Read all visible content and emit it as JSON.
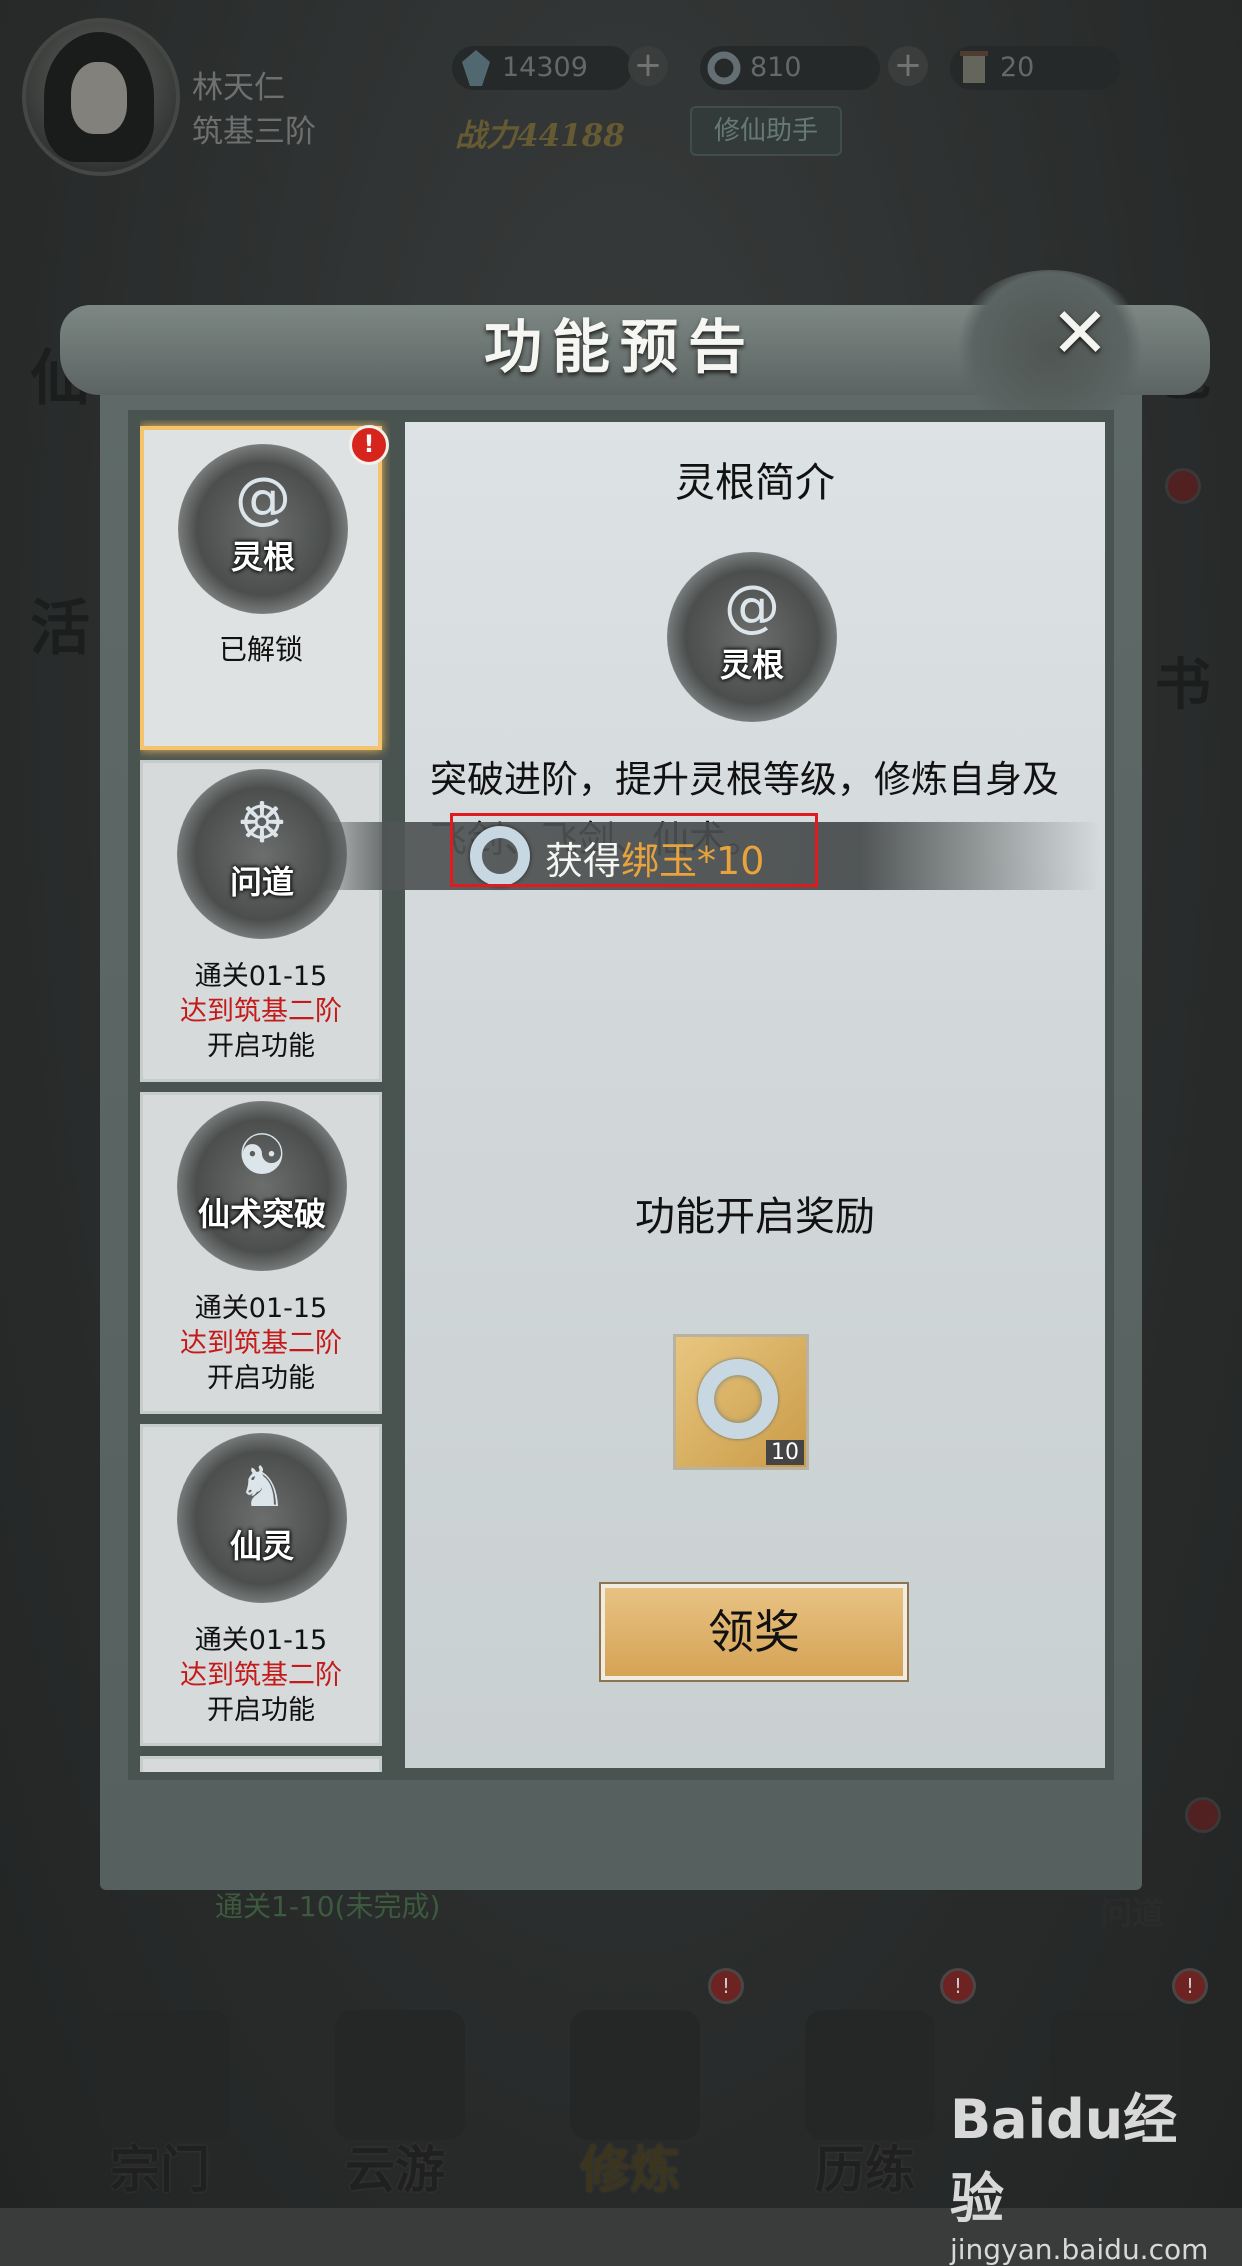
{
  "player": {
    "name": "林天仁",
    "rank": "筑基三阶"
  },
  "resources": [
    {
      "icon": "spirit-stone-icon",
      "value": "14309"
    },
    {
      "icon": "jade-ring-icon",
      "value": "810"
    },
    {
      "icon": "scroll-icon",
      "value": "20"
    }
  ],
  "power": "战力44188",
  "helper_button": "修仙助手",
  "modal": {
    "title": "功能预告",
    "close_icon": "close-icon"
  },
  "features": [
    {
      "emblem": "灵根",
      "icon": "spirit-root-icon",
      "status": "已解锁",
      "active": true,
      "badge": "!"
    },
    {
      "emblem": "问道",
      "icon": "meditation-icon",
      "cond1": "通关01-15",
      "cond2": "达到筑基二阶",
      "cond3": "开启功能"
    },
    {
      "emblem": "仙术突破",
      "icon": "yin-yang-icon",
      "cond1": "通关01-15",
      "cond2": "达到筑基二阶",
      "cond3": "开启功能"
    },
    {
      "emblem": "仙灵",
      "icon": "spirit-fox-icon",
      "cond1": "通关01-15",
      "cond2": "达到筑基二阶",
      "cond3": "开启功能"
    }
  ],
  "detail": {
    "title": "灵根简介",
    "emblem": "灵根",
    "description": "突破进阶，提升灵根等级，修炼自身及飞剑、飞剑、仙术。",
    "reward_title": "功能开启奖励",
    "reward_icon": "jade-ring-icon",
    "reward_count": "10",
    "claim_button": "领奖"
  },
  "toast": {
    "prefix": "获得",
    "item": "绑玉*10"
  },
  "quest_hint": "通关1-10(未完成)",
  "side_label": "问道",
  "nav": [
    {
      "label": "宗门",
      "icon": "sect-icon"
    },
    {
      "label": "云游",
      "icon": "travel-icon"
    },
    {
      "label": "修炼",
      "icon": "cultivate-icon",
      "active": true
    },
    {
      "label": "历练",
      "icon": "training-icon"
    },
    {
      "label": "",
      "icon": "scroll-icon"
    }
  ],
  "watermark": {
    "logo": "Baidu经验",
    "url": "jingyan.baidu.com"
  },
  "colors": {
    "accent_gold": "#f4c46c",
    "alert_red": "#c41a1a",
    "highlight_orange": "#e8a33d",
    "annotation_red": "#e11a20"
  }
}
